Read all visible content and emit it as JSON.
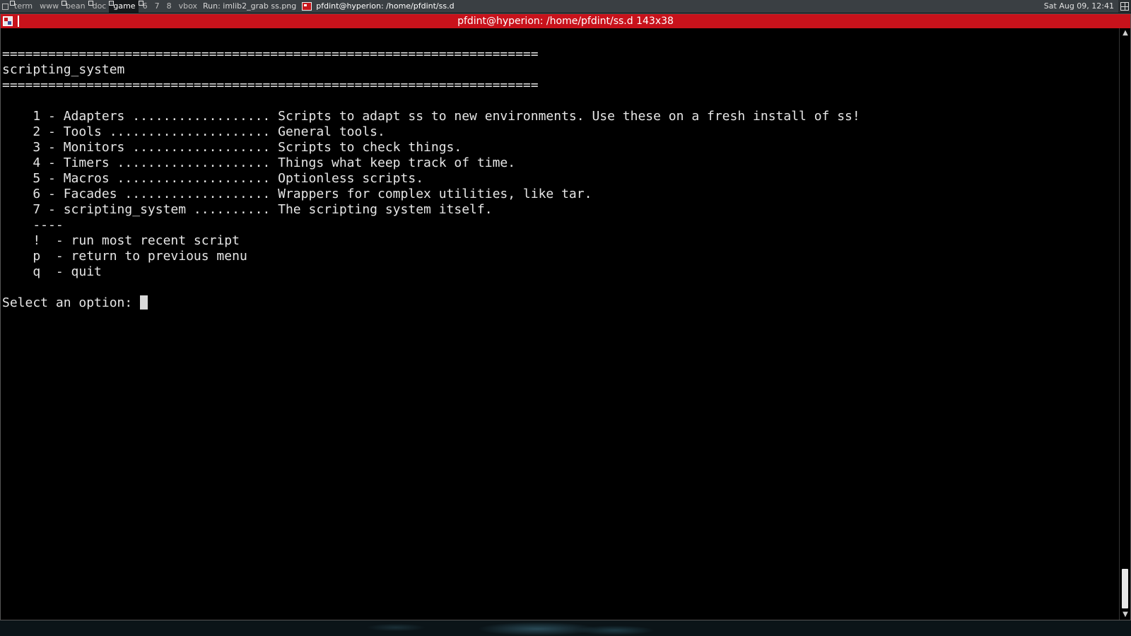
{
  "panel": {
    "workspaces": [
      {
        "label": "term",
        "has_window": true,
        "active": false
      },
      {
        "label": "www",
        "has_window": false,
        "active": false
      },
      {
        "label": "bean",
        "has_window": true,
        "active": false
      },
      {
        "label": "doc",
        "has_window": true,
        "active": false
      },
      {
        "label": "game",
        "has_window": true,
        "active": true
      },
      {
        "label": "6",
        "has_window": true,
        "active": false
      },
      {
        "label": "7",
        "has_window": false,
        "active": false
      },
      {
        "label": "8",
        "has_window": false,
        "active": false
      },
      {
        "label": "vbox",
        "has_window": false,
        "active": false
      }
    ],
    "run_box": "Run: imlib2_grab ss.png",
    "task_title": "pfdint@hyperion: /home/pfdint/ss.d",
    "clock": "Sat Aug 09, 12:41"
  },
  "window": {
    "title": "pfdint@hyperion: /home/pfdint/ss.d 143x38",
    "accent_color": "#c8121b"
  },
  "terminal": {
    "lines": [
      "",
      "======================================================================",
      "scripting_system",
      "======================================================================",
      "",
      "    1 - Adapters .................. Scripts to adapt ss to new environments. Use these on a fresh install of ss!",
      "    2 - Tools ..................... General tools.",
      "    3 - Monitors .................. Scripts to check things.",
      "    4 - Timers .................... Things what keep track of time.",
      "    5 - Macros .................... Optionless scripts.",
      "    6 - Facades ................... Wrappers for complex utilities, like tar.",
      "    7 - scripting_system .......... The scripting system itself.",
      "    ----",
      "    !  - run most recent script",
      "    p  - return to previous menu",
      "    q  - quit",
      ""
    ],
    "prompt": "Select an option: "
  }
}
